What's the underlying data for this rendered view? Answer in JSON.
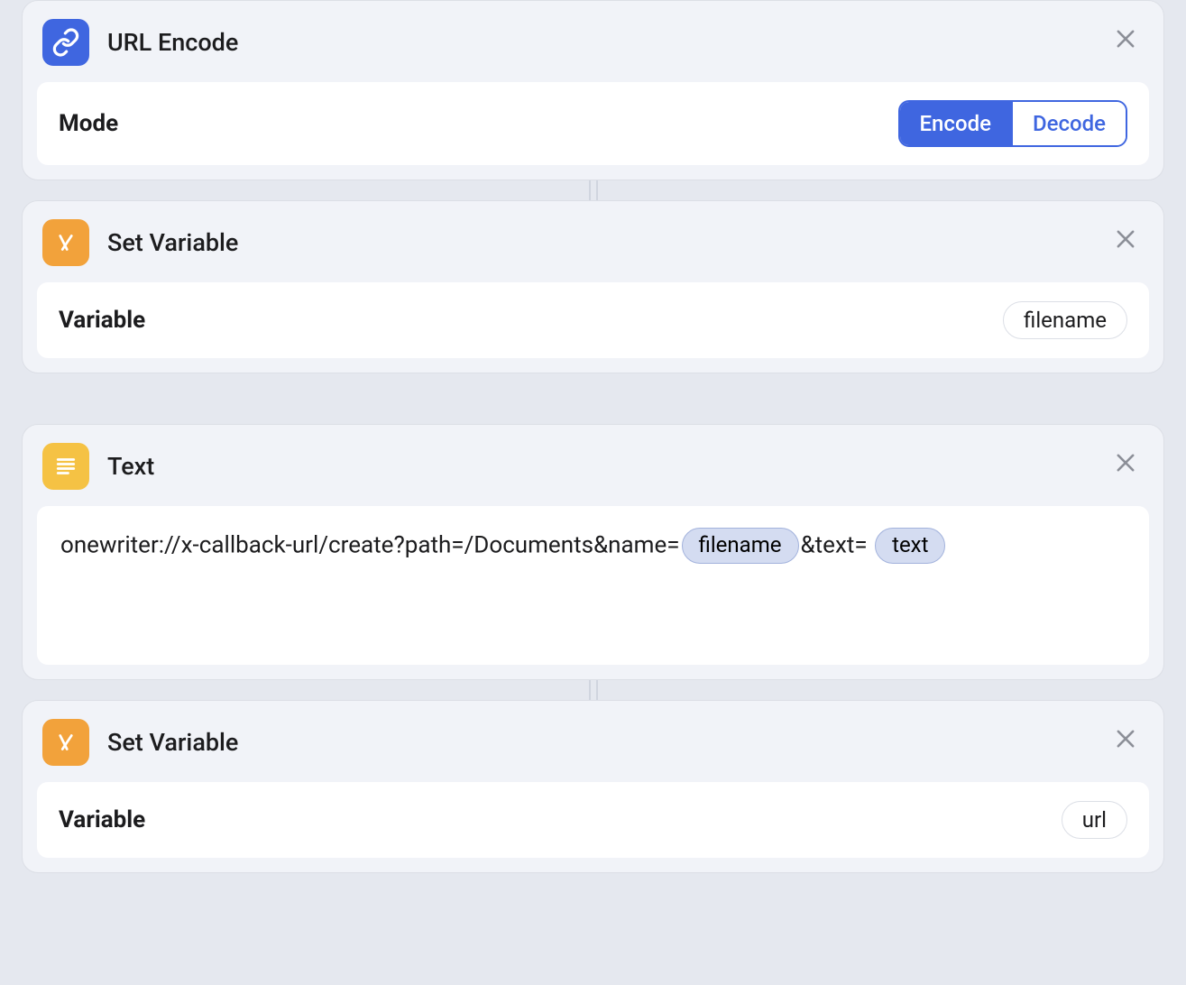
{
  "actions": {
    "url_encode": {
      "title": "URL Encode",
      "mode_label": "Mode",
      "encode_label": "Encode",
      "decode_label": "Decode",
      "selected": "Encode"
    },
    "set_variable_1": {
      "title": "Set Variable",
      "variable_label": "Variable",
      "variable_value": "filename"
    },
    "text": {
      "title": "Text",
      "content": {
        "part1": "onewriter://x-callback-url/create?path=/Documents&name=",
        "token1": "filename",
        "part2": "&text=",
        "token2": "text"
      }
    },
    "set_variable_2": {
      "title": "Set Variable",
      "variable_label": "Variable",
      "variable_value": "url"
    }
  }
}
